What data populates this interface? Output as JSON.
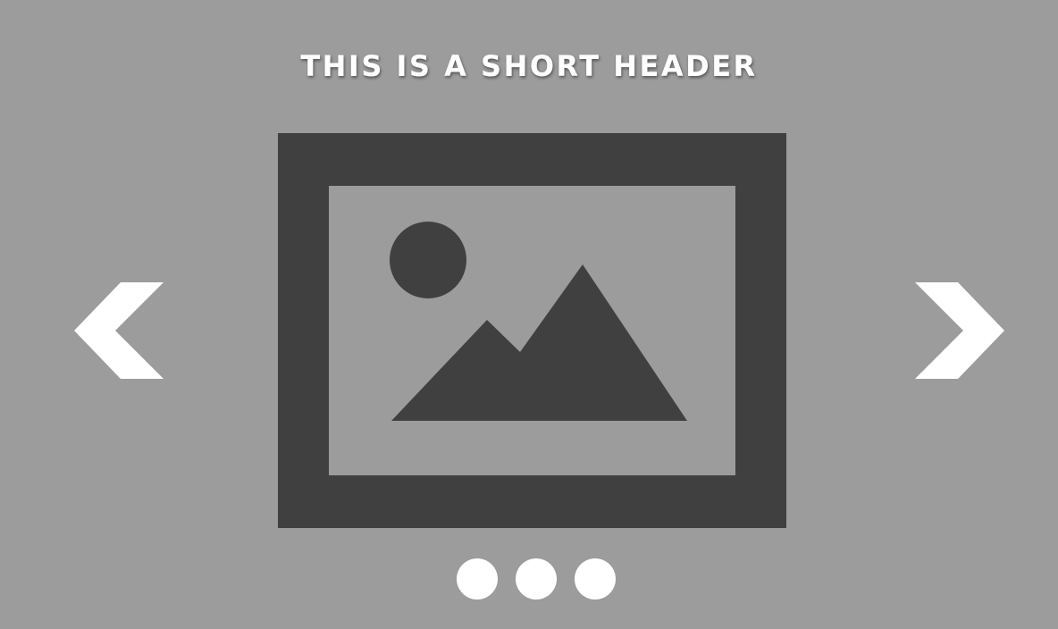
{
  "header": {
    "title": "THIS IS A SHORT HEADER"
  },
  "carousel": {
    "slide": {
      "icon": "image-placeholder-icon"
    },
    "prev_icon": "chevron-left-icon",
    "next_icon": "chevron-right-icon",
    "dots_count": 3,
    "colors": {
      "background": "#9c9c9c",
      "placeholder": "#404040",
      "controls": "#ffffff"
    }
  }
}
